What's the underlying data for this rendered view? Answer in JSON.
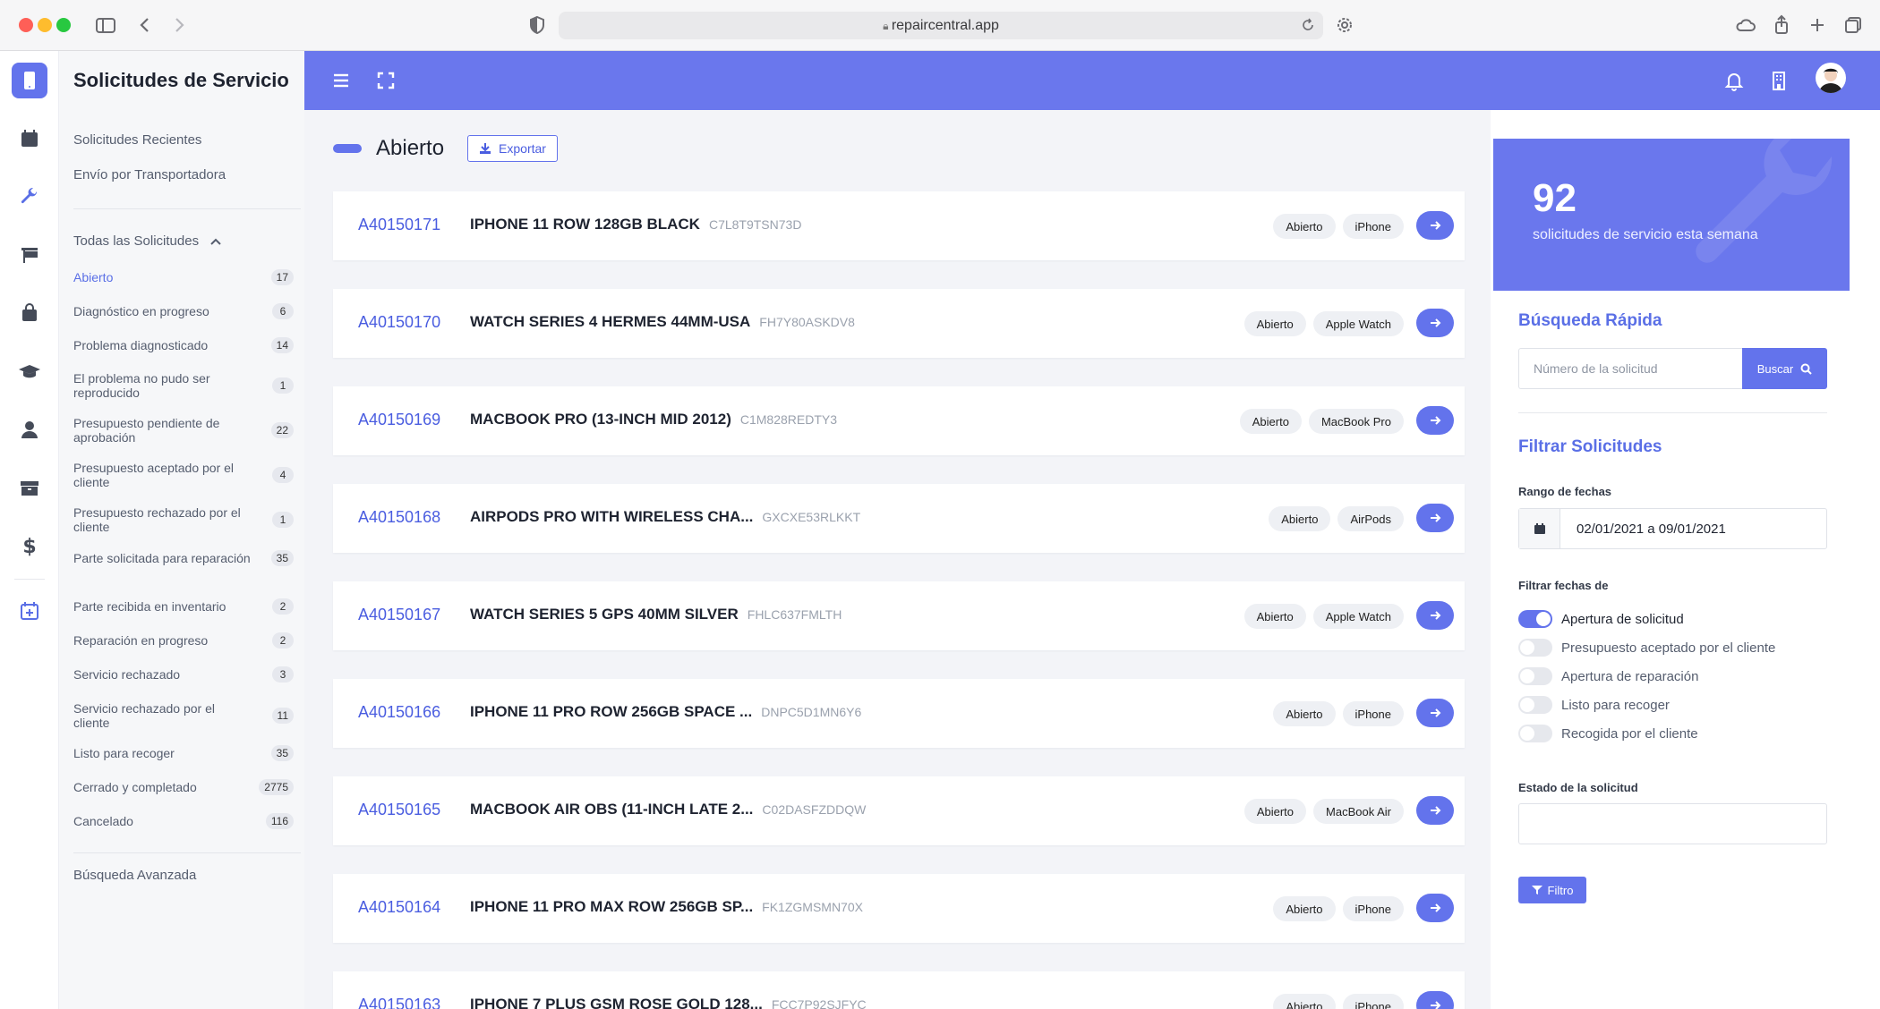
{
  "browser": {
    "url": "repaircentral.app"
  },
  "app": {
    "title": "Solicitudes de Servicio"
  },
  "rail": [
    {
      "icon": "phone-icon",
      "active": true
    },
    {
      "icon": "calendar-icon"
    },
    {
      "icon": "wrench-icon"
    },
    {
      "icon": "flag-icon"
    },
    {
      "icon": "shopping-bag-icon"
    },
    {
      "icon": "graduation-cap-icon"
    },
    {
      "icon": "user-icon"
    },
    {
      "icon": "box-icon"
    },
    {
      "icon": "dollar-icon"
    },
    {
      "icon": "calendar-plus-icon"
    }
  ],
  "sidebar": {
    "links": [
      "Solicitudes Recientes",
      "Envío por Transportadora"
    ],
    "group_label": "Todas las Solicitudes",
    "statuses": [
      {
        "label": "Abierto",
        "count": "17",
        "active": true
      },
      {
        "label": "Diagnóstico en progreso",
        "count": "6"
      },
      {
        "label": "Problema diagnosticado",
        "count": "14"
      },
      {
        "label": "El problema no pudo ser reproducido",
        "count": "1"
      },
      {
        "label": "Presupuesto pendiente de aprobación",
        "count": "22"
      },
      {
        "label": "Presupuesto aceptado por el cliente",
        "count": "4"
      },
      {
        "label": "Presupuesto rechazado por el cliente",
        "count": "1"
      },
      {
        "label": "Parte solicitada para reparación",
        "count": "35"
      },
      {
        "label": "Parte recibida en inventario",
        "count": "2"
      },
      {
        "label": "Reparación en progreso",
        "count": "2"
      },
      {
        "label": "Servicio rechazado",
        "count": "3"
      },
      {
        "label": "Servicio rechazado por el cliente",
        "count": "11"
      },
      {
        "label": "Listo para recoger",
        "count": "35"
      },
      {
        "label": "Cerrado y completado",
        "count": "2775"
      },
      {
        "label": "Cancelado",
        "count": "116"
      }
    ],
    "advanced_search": "Búsqueda Avanzada"
  },
  "main": {
    "title": "Abierto",
    "export_label": "Exportar",
    "requests": [
      {
        "id": "A40150171",
        "title": "IPHONE 11 ROW 128GB BLACK",
        "serial": "C7L8T9TSN73D",
        "tags": [
          "Abierto",
          "iPhone"
        ]
      },
      {
        "id": "A40150170",
        "title": "WATCH SERIES 4 HERMES 44MM-USA",
        "serial": "FH7Y80ASKDV8",
        "tags": [
          "Abierto",
          "Apple Watch"
        ]
      },
      {
        "id": "A40150169",
        "title": "MACBOOK PRO (13-INCH MID 2012)",
        "serial": "C1M828REDTY3",
        "tags": [
          "Abierto",
          "MacBook Pro"
        ]
      },
      {
        "id": "A40150168",
        "title": "AIRPODS PRO WITH WIRELESS CHA...",
        "serial": "GXCXE53RLKKT",
        "tags": [
          "Abierto",
          "AirPods"
        ]
      },
      {
        "id": "A40150167",
        "title": "WATCH SERIES 5 GPS 40MM SILVER",
        "serial": "FHLC637FMLTH",
        "tags": [
          "Abierto",
          "Apple Watch"
        ]
      },
      {
        "id": "A40150166",
        "title": "IPHONE 11 PRO ROW 256GB SPACE ...",
        "serial": "DNPC5D1MN6Y6",
        "tags": [
          "Abierto",
          "iPhone"
        ]
      },
      {
        "id": "A40150165",
        "title": "MACBOOK AIR OBS (11-INCH LATE 2...",
        "serial": "C02DASFZDDQW",
        "tags": [
          "Abierto",
          "MacBook Air"
        ]
      },
      {
        "id": "A40150164",
        "title": "IPHONE 11 PRO MAX ROW 256GB SP...",
        "serial": "FK1ZGMSMN70X",
        "tags": [
          "Abierto",
          "iPhone"
        ]
      },
      {
        "id": "A40150163",
        "title": "IPHONE 7 PLUS GSM ROSE GOLD 128...",
        "serial": "FCC7P92SJFYC",
        "tags": [
          "Abierto",
          "iPhone"
        ]
      }
    ]
  },
  "panel": {
    "stat_number": "92",
    "stat_label": "solicitudes de servicio esta semana",
    "quick_search_title": "Búsqueda Rápida",
    "search_placeholder": "Número de la solicitud",
    "search_button": "Buscar",
    "filter_title": "Filtrar Solicitudes",
    "date_range_label": "Rango de fechas",
    "date_range_value": "02/01/2021 a 09/01/2021",
    "filter_dates_label": "Filtrar fechas de",
    "toggles": [
      {
        "label": "Apertura de solicitud",
        "on": true
      },
      {
        "label": "Presupuesto aceptado por el cliente",
        "on": false
      },
      {
        "label": "Apertura de reparación",
        "on": false
      },
      {
        "label": "Listo para recoger",
        "on": false
      },
      {
        "label": "Recogida por el cliente",
        "on": false
      }
    ],
    "state_label": "Estado de la solicitud",
    "filter_button": "Filtro"
  },
  "colors": {
    "accent": "#6373ec",
    "header": "#6a77ed"
  }
}
